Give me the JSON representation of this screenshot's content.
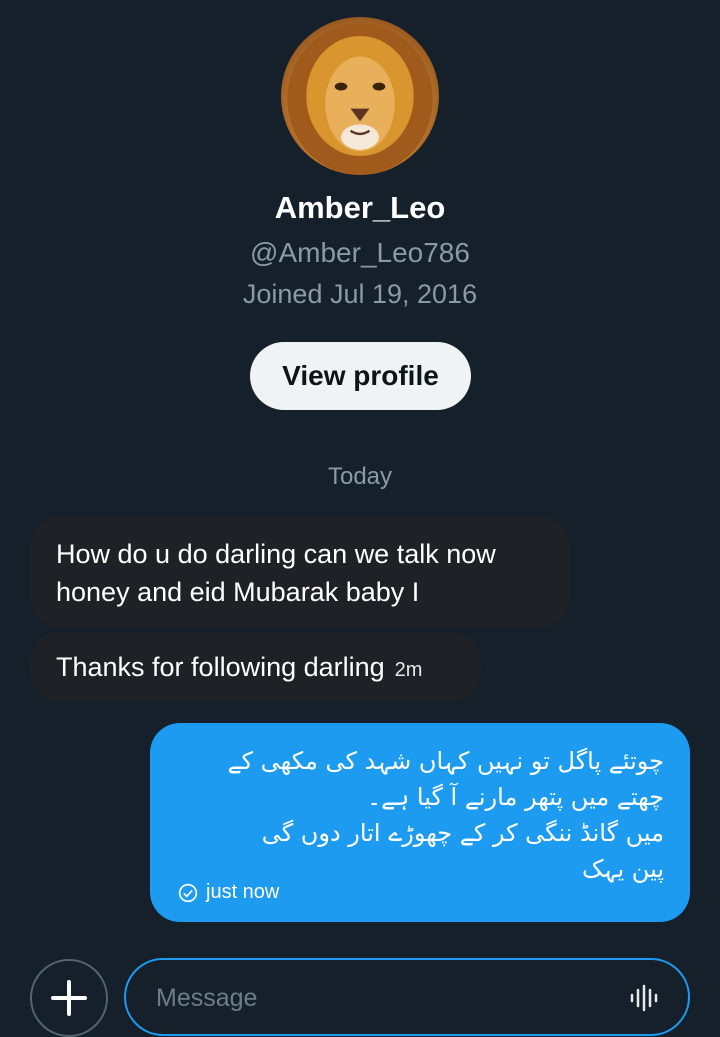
{
  "profile": {
    "name": "Amber_Leo",
    "handle": "@Amber_Leo786",
    "joined": "Joined Jul 19, 2016",
    "view_profile_label": "View profile",
    "avatar_icon": "lion-avatar"
  },
  "conversation": {
    "day_separator": "Today",
    "incoming": [
      {
        "text": "How do u do darling can we talk now honey and eid Mubarak baby I",
        "time": ""
      },
      {
        "text": "Thanks for following darling",
        "time": "2m"
      }
    ],
    "outgoing": [
      {
        "text": "چوتئے پاگل تو نہیں کہاں شہد کی مکھی کے\nچھتے میں پتھر مارنے آ گیا ہے۔\nمیں گانڈ ننگی کر کے چھوڑے اتار دوں گی\nپین یہک",
        "status": "just now",
        "status_icon": "check-circle-icon"
      }
    ]
  },
  "composer": {
    "placeholder": "Message",
    "add_icon": "plus-icon",
    "voice_icon": "voice-waveform-icon"
  },
  "colors": {
    "background": "#15202b",
    "accent": "#1d9bf0",
    "muted_text": "#8b98a5"
  }
}
